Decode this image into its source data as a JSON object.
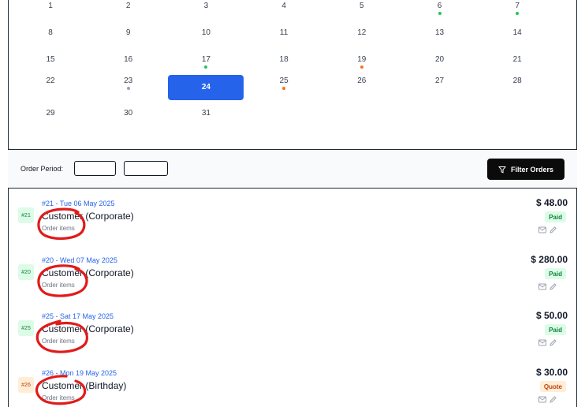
{
  "calendar": {
    "weeks": [
      [
        {
          "d": "1"
        },
        {
          "d": "2"
        },
        {
          "d": "3"
        },
        {
          "d": "4"
        },
        {
          "d": "5"
        },
        {
          "d": "6",
          "dot": "green"
        },
        {
          "d": "7",
          "dot": "green"
        }
      ],
      [
        {
          "d": "8"
        },
        {
          "d": "9"
        },
        {
          "d": "10"
        },
        {
          "d": "11"
        },
        {
          "d": "12"
        },
        {
          "d": "13"
        },
        {
          "d": "14"
        }
      ],
      [
        {
          "d": "15"
        },
        {
          "d": "16"
        },
        {
          "d": "17",
          "dot": "green"
        },
        {
          "d": "18"
        },
        {
          "d": "19",
          "dot": "orange"
        },
        {
          "d": "20"
        },
        {
          "d": "21"
        }
      ],
      [
        {
          "d": "22"
        },
        {
          "d": "23",
          "dot": "gray"
        },
        {
          "d": "24",
          "selected": true
        },
        {
          "d": "25",
          "dot": "orange"
        },
        {
          "d": "26"
        },
        {
          "d": "27"
        },
        {
          "d": "28"
        }
      ],
      [
        {
          "d": "29"
        },
        {
          "d": "30"
        },
        {
          "d": "31"
        }
      ]
    ]
  },
  "colors": {
    "green": "#22c55e",
    "orange": "#f97316",
    "gray": "#9ca3af",
    "selected": "#2563eb"
  },
  "filter": {
    "period_label": "Order Period:",
    "from_value": "",
    "to_value": "",
    "button_label": "Filter Orders",
    "button_icon": "filter-icon"
  },
  "orders": [
    {
      "badge": "#21",
      "head": "#21 - Tue 06 May 2025",
      "customer": "Customer (Corporate)",
      "items": "Order items",
      "amount": "$ 48.00",
      "status": "Paid",
      "kind": "paid"
    },
    {
      "badge": "#20",
      "head": "#20 - Wed 07 May 2025",
      "customer": "Customer (Corporate)",
      "items": "Order items",
      "amount": "$ 280.00",
      "status": "Paid",
      "kind": "paid"
    },
    {
      "badge": "#25",
      "head": "#25 - Sat 17 May 2025",
      "customer": "Customer (Corporate)",
      "items": "Order items",
      "amount": "$ 50.00",
      "status": "Paid",
      "kind": "paid"
    },
    {
      "badge": "#26",
      "head": "#26 - Mon 19 May 2025",
      "customer": "Customer (Birthday)",
      "items": "Order items",
      "amount": "$ 30.00",
      "status": "Quote",
      "kind": "quote"
    }
  ],
  "icons": {
    "email": "mail-icon",
    "edit": "pencil-icon"
  }
}
